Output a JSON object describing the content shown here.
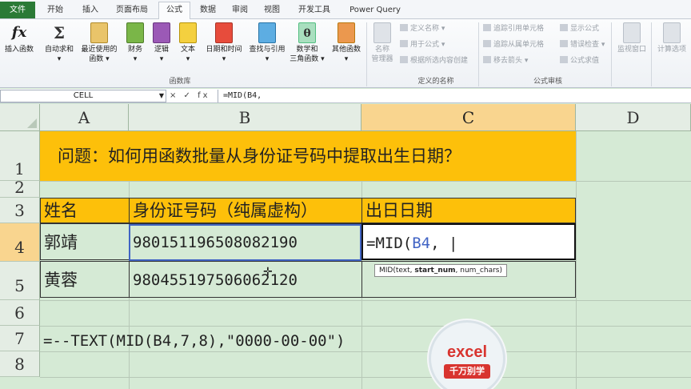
{
  "ribbon_tabs": [
    "文件",
    "开始",
    "插入",
    "页面布局",
    "公式",
    "数据",
    "审阅",
    "视图",
    "开发工具",
    "Power Query"
  ],
  "active_tab": "公式",
  "ribbon": {
    "insert_function": "插入函数",
    "autosum": "自动求和",
    "recent": "最近使用的",
    "recent2": "函数",
    "financial": "财务",
    "logical": "逻辑",
    "text": "文本",
    "datetime": "日期和时间",
    "lookup": "查找与引用",
    "math": "数学和",
    "math2": "三角函数",
    "more": "其他函数",
    "group_library": "函数库",
    "name_manager": "名称",
    "name_manager2": "管理器",
    "define_name": "定义名称",
    "use_in_formula": "用于公式",
    "create_from_selection": "根据所选内容创建",
    "group_names": "定义的名称",
    "trace_precedents": "追踪引用单元格",
    "trace_dependents": "追踪从属单元格",
    "remove_arrows": "移去箭头",
    "show_formulas": "显示公式",
    "error_checking": "错误检查",
    "evaluate_formula": "公式求值",
    "group_auditing": "公式审核",
    "watch_window": "监视窗口",
    "calc_options": "计算选项"
  },
  "formula_bar": {
    "name_box": "CELL",
    "icons": "× ✓ fx",
    "content": "=MID(B4,"
  },
  "columns": [
    "A",
    "B",
    "C",
    "D"
  ],
  "rows": [
    "1",
    "2",
    "3",
    "4",
    "5",
    "6",
    "7",
    "8"
  ],
  "sheet": {
    "title": "问题：如何用函数批量从身份证号码中提取出生日期？",
    "headers": [
      "姓名",
      "身份证号码（纯属虚构）",
      "出日日期"
    ],
    "r4_name": "郭靖",
    "r4_id": "980151196508082190",
    "r4_formula_prefix": "=MID(",
    "r4_formula_ref": "B4",
    "r4_formula_suffix": ",",
    "r5_name": "黄蓉",
    "r5_id": "980455197506062120",
    "formula_note": "=--TEXT(MID(B4,7,8),\"0000-00-00\")",
    "tooltip_pre": "MID(text, ",
    "tooltip_bold": "start_num",
    "tooltip_post": ", num_chars)"
  },
  "logo": {
    "word": "excel",
    "sub": "千万别学"
  },
  "colors": {
    "sheet_bg": "#d5ead5",
    "highlight": "#fdc00a",
    "selected_header": "#f9d58f",
    "file_tab": "#2b7a36",
    "reference_blue": "#4063c4",
    "logo_red": "#d8342f"
  }
}
